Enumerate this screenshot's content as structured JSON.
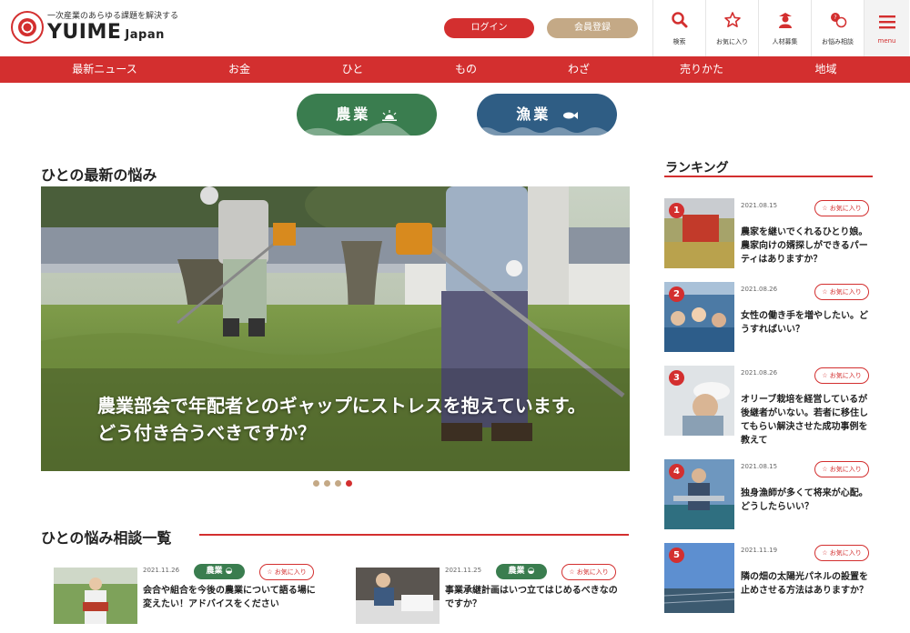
{
  "header": {
    "tagline": "一次産業のあらゆる課題を解決する",
    "logo_main": "YUIME",
    "logo_sub": "Japan",
    "login_label": "ログイン",
    "register_label": "会員登録",
    "icons": [
      {
        "name": "search",
        "label": "検索"
      },
      {
        "name": "star",
        "label": "お気に入り"
      },
      {
        "name": "person",
        "label": "人材募集"
      },
      {
        "name": "consult",
        "label": "お悩み相談"
      }
    ],
    "menu_label": "menu"
  },
  "nav": [
    "最新ニュース",
    "お金",
    "ひと",
    "もの",
    "わざ",
    "売りかた",
    "地域"
  ],
  "categories": {
    "agri": "農業",
    "fish": "漁業"
  },
  "latest": {
    "title": "ひとの最新の悩み",
    "caption": "農業部会で年配者とのギャップにストレスを抱えています。どう付き合うべきですか？",
    "active_slide": 4,
    "slide_count": 4
  },
  "consult_list": {
    "title": "ひとの悩み相談一覧",
    "fav_label": "お気に入り",
    "items": [
      {
        "date": "2021.11.26",
        "tag": "農業",
        "title": "会合や組合を今後の農業について語る場に変えたい！アドバイスをください"
      },
      {
        "date": "2021.11.25",
        "tag": "農業",
        "title": "事業承継計画はいつ立てはじめるべきなのですか？"
      }
    ]
  },
  "ranking": {
    "title": "ランキング",
    "fav_label": "お気に入り",
    "items": [
      {
        "rank": "1",
        "date": "2021.08.15",
        "title": "農家を継いでくれるひとり娘。農家向けの婿探しができるパーティはありますか？"
      },
      {
        "rank": "2",
        "date": "2021.08.26",
        "title": "女性の働き手を増やしたい。どうすればいい？"
      },
      {
        "rank": "3",
        "date": "2021.08.26",
        "title": "オリーブ栽培を経営しているが後継者がいない。若者に移住してもらい解決させた成功事例を教えて"
      },
      {
        "rank": "4",
        "date": "2021.08.15",
        "title": "独身漁師が多くて将来が心配。どうしたらいい？"
      },
      {
        "rank": "5",
        "date": "2021.11.19",
        "title": "隣の畑の太陽光パネルの設置を止めさせる方法はありますか？"
      }
    ]
  },
  "colors": {
    "accent": "#d32f2f",
    "agri": "#3a7d4f",
    "fish": "#2f5d84",
    "beige": "#c4a986"
  }
}
